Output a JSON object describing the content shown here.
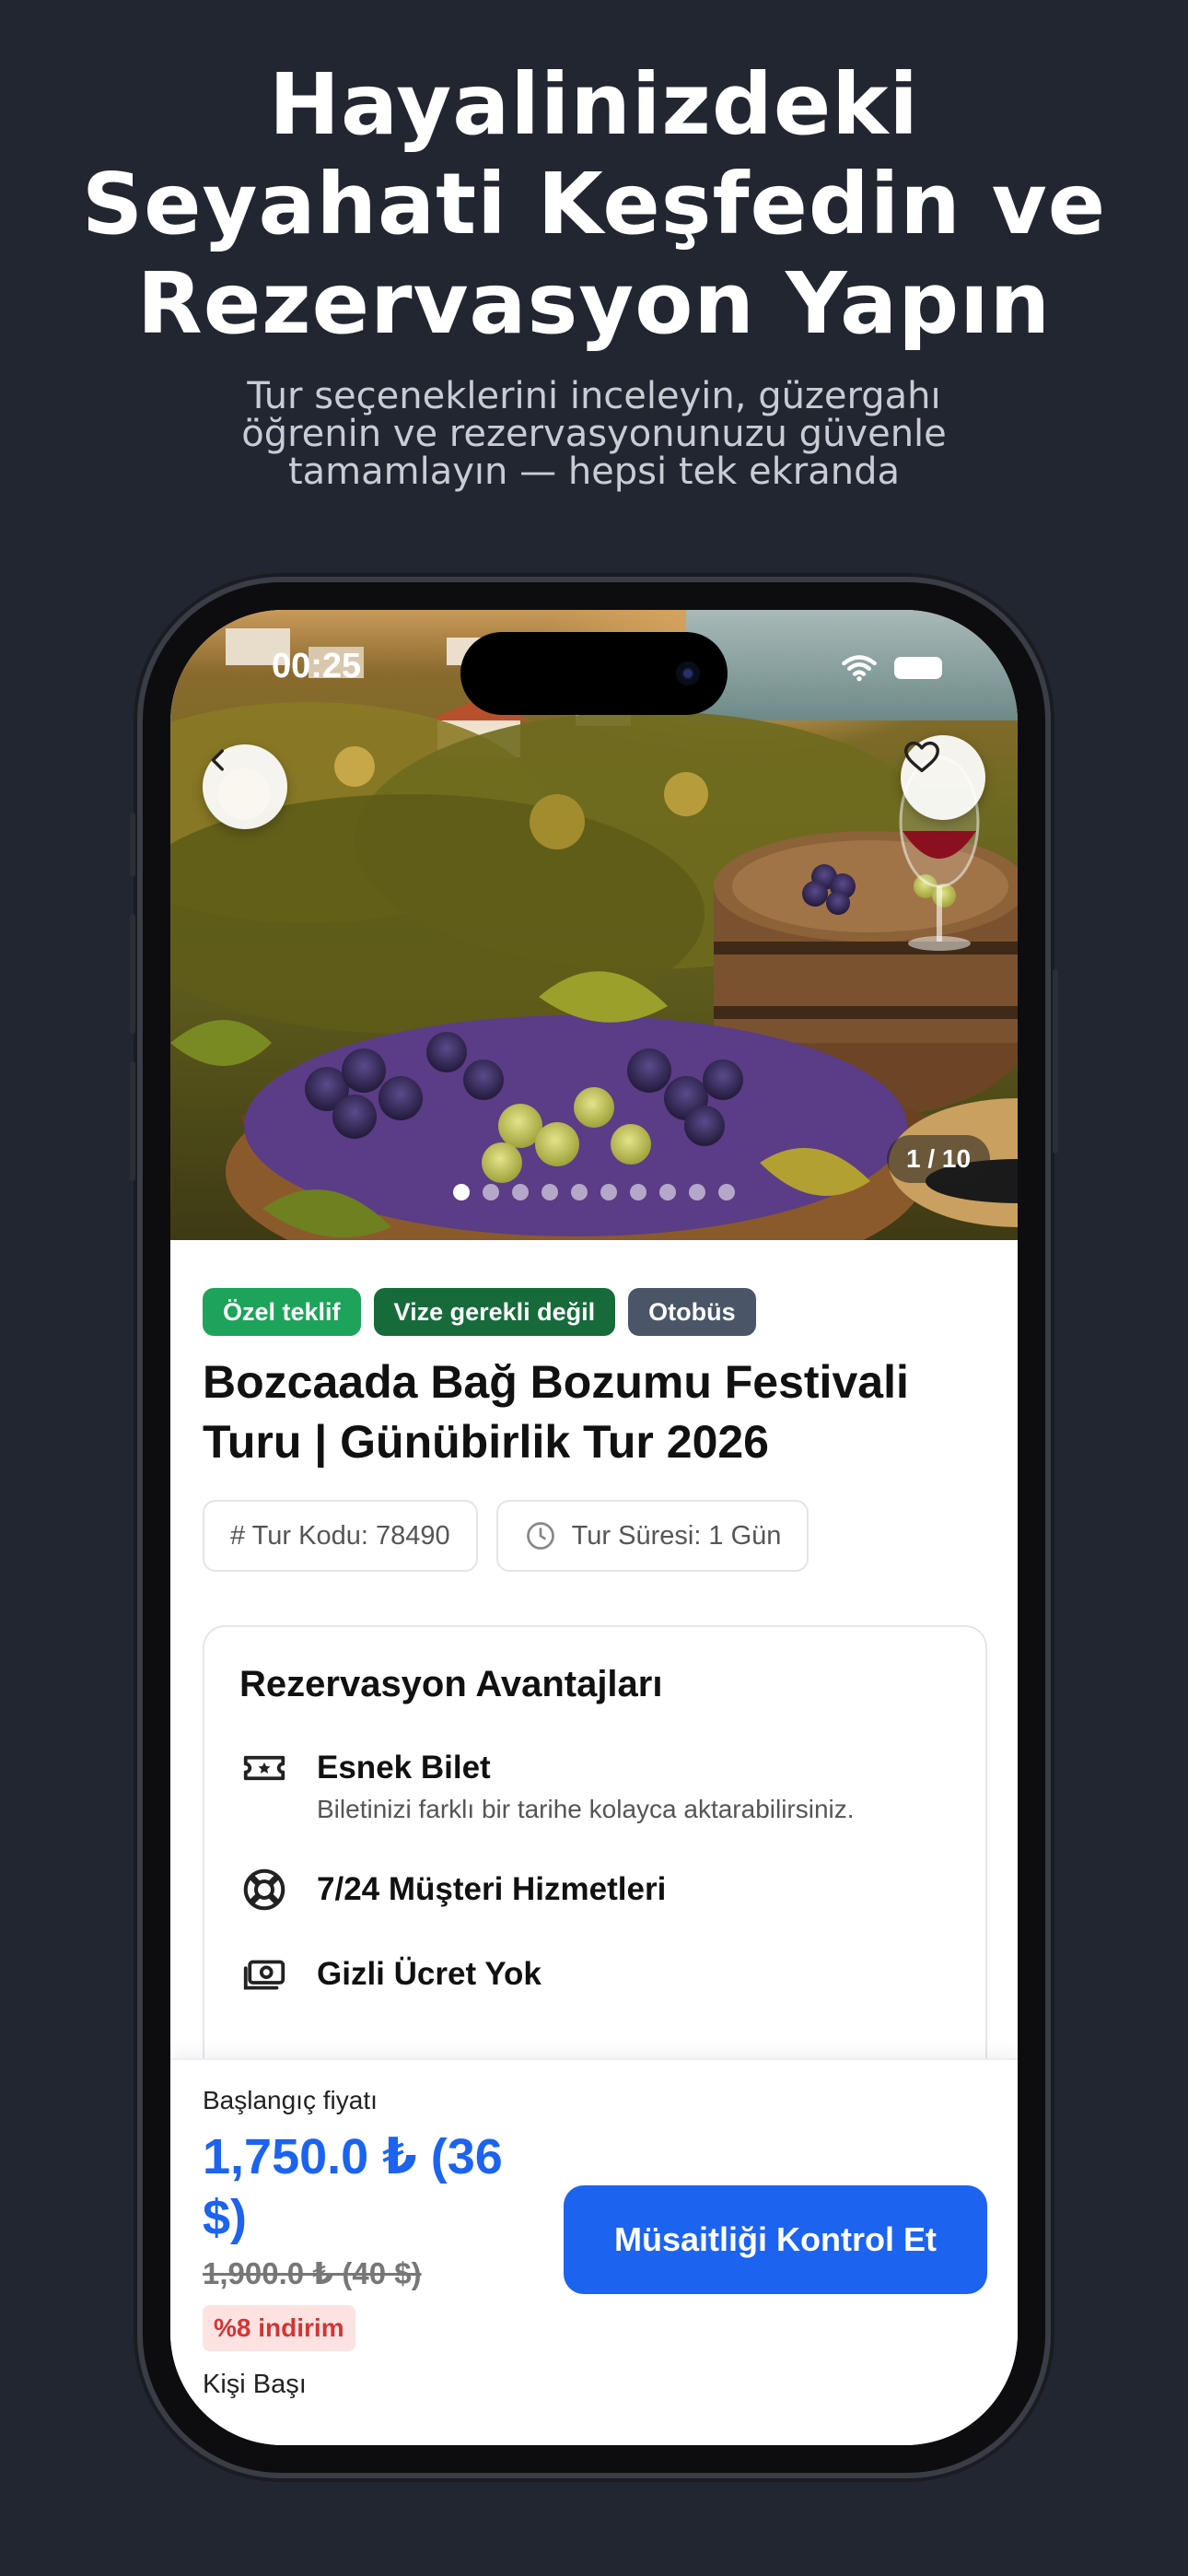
{
  "headline": {
    "lines": [
      "Hayalinizdeki",
      "Seyahati Keşfedin ve",
      "Rezervasyon Yapın"
    ]
  },
  "subhead": {
    "lines": [
      "Tur seçeneklerini inceleyin, güzergahı",
      "öğrenin ve rezervasyonunuzu güvenle",
      "tamamlayın — hepsi tek ekranda"
    ]
  },
  "status_bar": {
    "time": "00:25"
  },
  "hero": {
    "counter": "1 / 10",
    "total_images": 10,
    "active_index": 0
  },
  "badges": [
    {
      "label": "Özel teklif",
      "color": "#1ea35a"
    },
    {
      "label": "Vize gerekli değil",
      "color": "#176b3b"
    },
    {
      "label": "Otobüs",
      "color": "#4a5568"
    }
  ],
  "tour": {
    "title_lines": [
      "Bozcaada Bağ Bozumu Festivali",
      "Turu | Günübirlik Tur 2026"
    ],
    "code": "# Tur Kodu: 78490",
    "duration": "Tur Süresi: 1 Gün"
  },
  "advantages": {
    "title": "Rezervasyon Avantajları",
    "items": [
      {
        "icon": "ticket-icon",
        "title": "Esnek Bilet",
        "desc": "Biletinizi farklı bir tarihe kolayca aktarabilirsiniz."
      },
      {
        "icon": "lifebuoy-icon",
        "title": "7/24 Müşteri Hizmetleri",
        "desc": ""
      },
      {
        "icon": "cash-icon",
        "title": "Gizli Ücret Yok",
        "desc": ""
      }
    ]
  },
  "pricing": {
    "label": "Başlangıç fiyatı",
    "price_lines": [
      "1,750.0 ₺ (36",
      "$)"
    ],
    "old_price": "1,900.0 ₺ (40 $)",
    "discount": "%8 indirim",
    "per": "Kişi Başı",
    "cta": "Müsaitliği Kontrol Et",
    "accent": "#1c63f0"
  }
}
